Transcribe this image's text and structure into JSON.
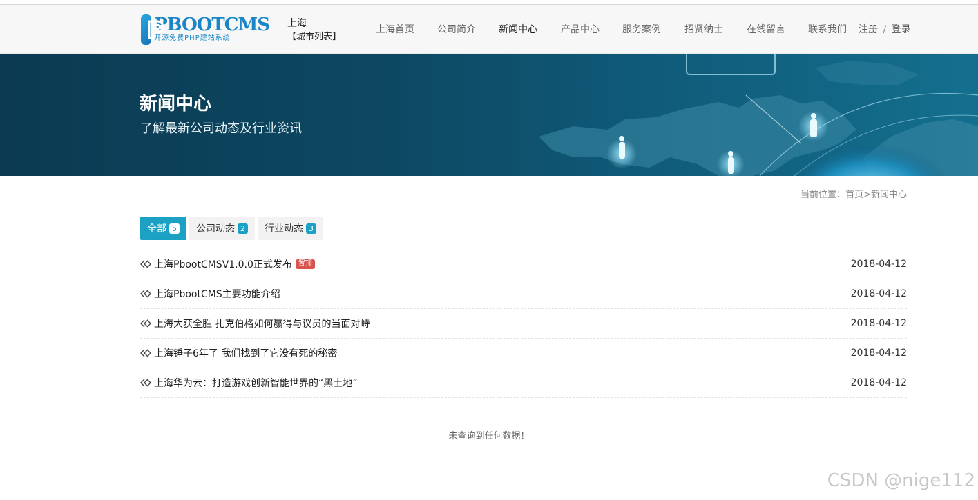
{
  "header": {
    "logo_title": "PBOOTCMS",
    "logo_sub": "开源免费PHP建站系统",
    "city": "上海",
    "city_list": "【城市列表】",
    "nav": [
      {
        "label": "上海首页"
      },
      {
        "label": "公司简介"
      },
      {
        "label": "新闻中心",
        "active": true
      },
      {
        "label": "产品中心"
      },
      {
        "label": "服务案例"
      },
      {
        "label": "招贤纳士"
      },
      {
        "label": "在线留言"
      },
      {
        "label": "联系我们"
      }
    ],
    "register": "注册",
    "separator": "/",
    "login": "登录"
  },
  "banner": {
    "title": "新闻中心",
    "subtitle": "了解最新公司动态及行业资讯"
  },
  "breadcrumb": {
    "prefix": "当前位置：",
    "home": "首页",
    "sep": ">",
    "current": "新闻中心"
  },
  "tabs": [
    {
      "label": "全部",
      "count": "5",
      "active": true
    },
    {
      "label": "公司动态",
      "count": "2"
    },
    {
      "label": "行业动态",
      "count": "3"
    }
  ],
  "news": [
    {
      "title": "上海PbootCMSV1.0.0正式发布",
      "badge": "置顶",
      "date": "2018-04-12"
    },
    {
      "title": "上海PbootCMS主要功能介绍",
      "date": "2018-04-12"
    },
    {
      "title": "上海大获全胜 扎克伯格如何赢得与议员的当面对峙",
      "date": "2018-04-12"
    },
    {
      "title": "上海锤子6年了 我们找到了它没有死的秘密",
      "date": "2018-04-12"
    },
    {
      "title": "上海华为云：打造游戏创新智能世界的“黑土地”",
      "date": "2018-04-12"
    }
  ],
  "empty_message": "未查询到任何数据！",
  "watermark": "CSDN @nige112",
  "colors": {
    "accent": "#1ba1c3",
    "logo_blue": "#1a86c8",
    "badge_red": "#d9534f",
    "banner_dark": "#0b3a52"
  }
}
